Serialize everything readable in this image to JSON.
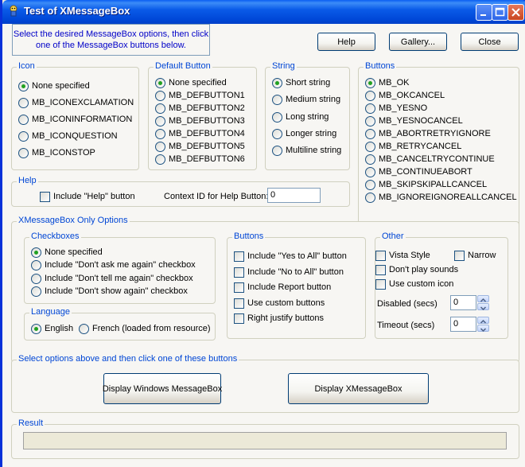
{
  "window": {
    "title": "Test of XMessageBox"
  },
  "info_text": "Select the desired MessageBox options, then click one of the MessageBox buttons below.",
  "top_buttons": {
    "help": "Help",
    "gallery": "Gallery...",
    "close": "Close"
  },
  "icon_group": {
    "label": "Icon",
    "options": [
      "None specified",
      "MB_ICONEXCLAMATION",
      "MB_ICONINFORMATION",
      "MB_ICONQUESTION",
      "MB_ICONSTOP"
    ],
    "selected": 0
  },
  "default_button_group": {
    "label": "Default Button",
    "options": [
      "None specified",
      "MB_DEFBUTTON1",
      "MB_DEFBUTTON2",
      "MB_DEFBUTTON3",
      "MB_DEFBUTTON4",
      "MB_DEFBUTTON5",
      "MB_DEFBUTTON6"
    ],
    "selected": 0
  },
  "string_group": {
    "label": "String",
    "options": [
      "Short string",
      "Medium string",
      "Long string",
      "Longer string",
      "Multiline string"
    ],
    "selected": 0
  },
  "buttons_group": {
    "label": "Buttons",
    "options": [
      "MB_OK",
      "MB_OKCANCEL",
      "MB_YESNO",
      "MB_YESNOCANCEL",
      "MB_ABORTRETRYIGNORE",
      "MB_RETRYCANCEL",
      "MB_CANCELTRYCONTINUE",
      "MB_CONTINUEABORT",
      "MB_SKIPSKIPALLCANCEL",
      "MB_IGNOREIGNOREALLCANCEL"
    ],
    "selected": 0
  },
  "help_group": {
    "label": "Help",
    "include_help_label": "Include \"Help\" button",
    "context_id_label": "Context ID for Help Button:",
    "context_id_value": "0"
  },
  "xmb_group": {
    "label": "XMessageBox Only Options",
    "checkboxes": {
      "label": "Checkboxes",
      "options": [
        "None specified",
        "Include \"Don't ask me again\" checkbox",
        "Include \"Don't tell me again\" checkbox",
        "Include \"Don't show again\" checkbox"
      ],
      "selected": 0
    },
    "language": {
      "label": "Language",
      "options": [
        "English",
        "French (loaded from resource)"
      ],
      "selected": 0
    },
    "buttons": {
      "label": "Buttons",
      "options": [
        "Include \"Yes to All\" button",
        "Include \"No to All\" button",
        "Include Report button",
        "Use custom buttons",
        "Right justify buttons"
      ]
    },
    "other": {
      "label": "Other",
      "vista_style": "Vista Style",
      "narrow": "Narrow",
      "dont_play_sounds": "Don't play sounds",
      "use_custom_icon": "Use custom icon",
      "disabled_label": "Disabled (secs)",
      "disabled_value": "0",
      "timeout_label": "Timeout (secs)",
      "timeout_value": "0"
    }
  },
  "display_group": {
    "label": "Select options above and then click one of these buttons",
    "windows_btn": "Display Windows MessageBox",
    "xmb_btn": "Display XMessageBox"
  },
  "result_group": {
    "label": "Result",
    "value": ""
  },
  "colors": {
    "title_bar": "#0A5BE8",
    "group_label": "#0046D5",
    "info_text": "#0000C8",
    "radio_dot": "#21A121"
  }
}
